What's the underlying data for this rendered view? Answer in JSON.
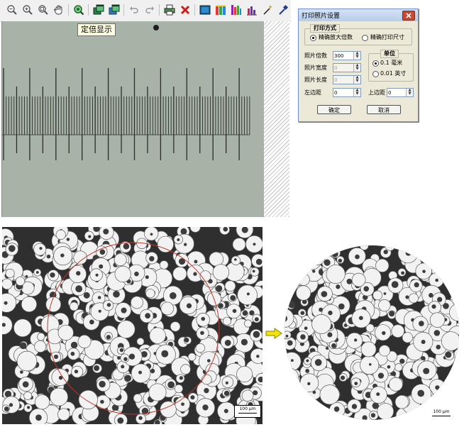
{
  "tooltip": "定倍显示",
  "icons": [
    "zoom-out-icon",
    "zoom-in-icon",
    "zoom-fit-icon",
    "hand-icon",
    "magnify-search-icon",
    "window-stack-icon",
    "window-stack-alt-icon",
    "undo-icon",
    "redo-icon",
    "print-icon",
    "delete-icon",
    "film-icon",
    "color-bars-icon",
    "color-levels-icon",
    "histogram-icon",
    "magic-wand-icon",
    "eyedropper-icon"
  ],
  "dialog": {
    "title": "打印照片设置",
    "print_mode": {
      "legend": "打印方式",
      "option_zoom": "精确放大倍数",
      "option_size": "精确打印尺寸"
    },
    "fields": {
      "magnification_label": "照片倍数",
      "magnification_value": "300",
      "width_label": "照片宽度",
      "width_value": "0",
      "length_label": "照片长度",
      "length_value": "0",
      "left_margin_label": "左边距",
      "left_margin_value": "0",
      "top_margin_label": "上边距",
      "top_margin_value": "0"
    },
    "unit": {
      "legend": "单位",
      "option_mm": "0.1 毫米",
      "option_inch": "0.01 英寸"
    },
    "ok_label": "确定",
    "cancel_label": "取消"
  },
  "scale_left": "100 µm",
  "scale_right": "100 µm",
  "colors": {
    "viewport": "#a8b3a7",
    "ruler_line": "#2a2d2a",
    "circle": "#c0392b",
    "arrow": "#f2e600",
    "dialog_bg": "#ece9d8"
  }
}
